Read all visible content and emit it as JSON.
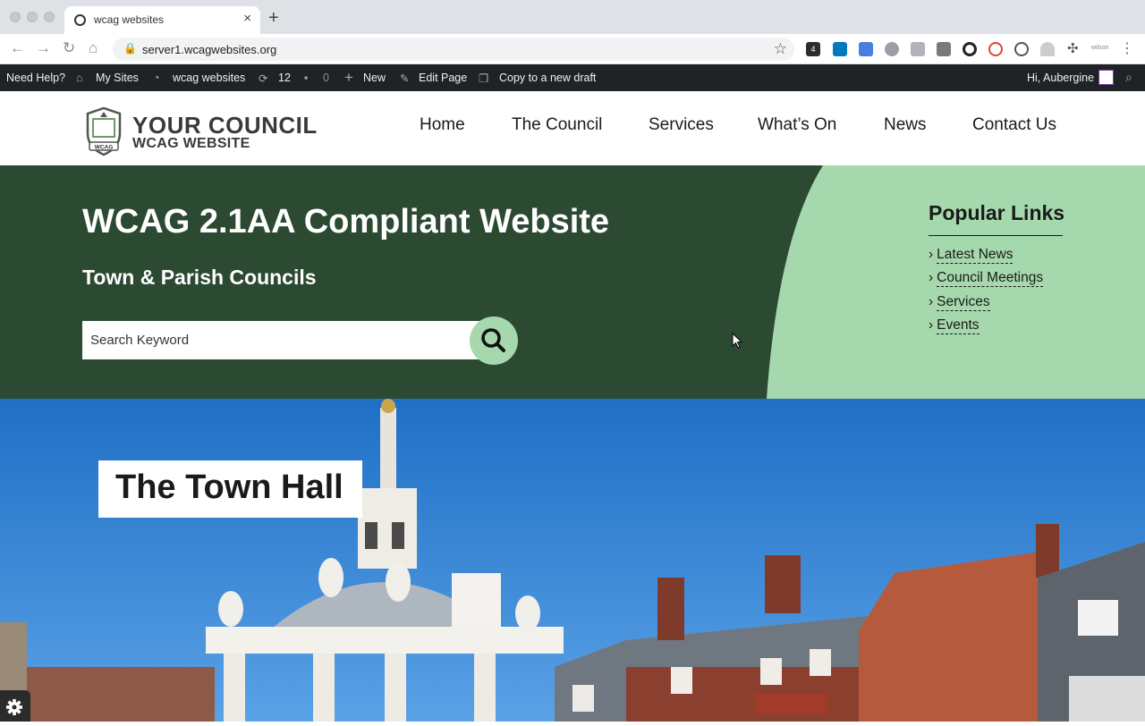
{
  "browser": {
    "tab_title": "wcag websites",
    "new_tab": "+",
    "url": "server1.wcagwebsites.org",
    "extension_badge": "4",
    "profile_label": "wilson"
  },
  "admin_bar": {
    "need_help": "Need Help?",
    "my_sites": "My Sites",
    "site_name": "wcag websites",
    "updates_count": "12",
    "comments_count": "0",
    "new_label": "New",
    "edit_page": "Edit Page",
    "copy_draft": "Copy to a new draft",
    "greeting": "Hi, Aubergine"
  },
  "site": {
    "logo_line1": "YOUR COUNCIL",
    "logo_line2": "WCAG WEBSITE",
    "logo_badge": "WCAG",
    "nav": [
      "Home",
      "The Council",
      "Services",
      "What’s On",
      "News",
      "Contact Us"
    ]
  },
  "hero": {
    "title": "WCAG 2.1AA Compliant Website",
    "subtitle": "Town & Parish Councils",
    "search_placeholder": "Search Keyword",
    "popular_title": "Popular Links",
    "popular_links": [
      "Latest News",
      "Council Meetings",
      "Services",
      "Events"
    ]
  },
  "photo": {
    "title": "The Town Hall"
  },
  "colors": {
    "hero_bg": "#2c4a32",
    "hero_accent": "#a6d8ad",
    "admin_bar": "#1d2327"
  }
}
